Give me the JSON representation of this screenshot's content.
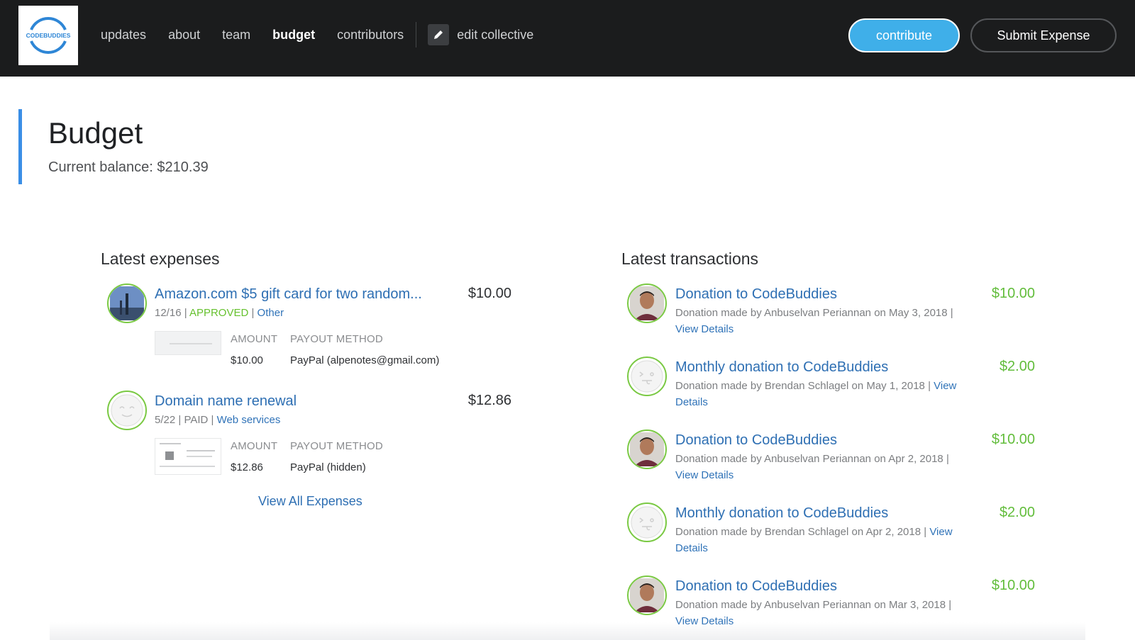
{
  "colors": {
    "topbar": "#1b1c1d",
    "accent": "#3a8ee6",
    "contribute": "#3fafe9",
    "green": "#62bd3b",
    "link": "#2e6fb3"
  },
  "logo": {
    "text": "CODEBUDDIES"
  },
  "nav": {
    "items": [
      "updates",
      "about",
      "team",
      "budget",
      "contributors"
    ],
    "active": "budget",
    "edit_label": "edit collective"
  },
  "buttons": {
    "contribute": "contribute",
    "submit_expense": "Submit Expense"
  },
  "header": {
    "title": "Budget",
    "balance": "Current balance: $210.39"
  },
  "expenses": {
    "title": "Latest expenses",
    "labels": {
      "amount": "AMOUNT",
      "payout": "PAYOUT METHOD"
    },
    "items": [
      {
        "title": "Amazon.com $5 gift card for two random...",
        "date": "12/16",
        "status": "APPROVED",
        "category": "Other",
        "amount": "$10.00",
        "detail_amount": "$10.00",
        "payout": "PayPal (alpenotes@gmail.com)"
      },
      {
        "title": "Domain name renewal",
        "date": "5/22",
        "status": "PAID",
        "category": "Web services",
        "amount": "$12.86",
        "detail_amount": "$12.86",
        "payout": "PayPal (hidden)"
      }
    ],
    "view_all": "View All Expenses"
  },
  "transactions": {
    "title": "Latest transactions",
    "view": "View",
    "details": "Details",
    "view_details": "View Details",
    "items": [
      {
        "title": "Donation to CodeBuddies",
        "desc": "Donation made by Anbuselvan Periannan on May 3, 2018 |",
        "amount": "$10.00",
        "avatar": "person-photo"
      },
      {
        "title": "Monthly donation to CodeBuddies",
        "desc": "Donation made by Brendan Schlagel on May 1, 2018 |",
        "amount": "$2.00",
        "avatar": "face-placeholder"
      },
      {
        "title": "Donation to CodeBuddies",
        "desc": "Donation made by Anbuselvan Periannan on Apr 2, 2018 |",
        "amount": "$10.00",
        "avatar": "person-photo"
      },
      {
        "title": "Monthly donation to CodeBuddies",
        "desc": "Donation made by Brendan Schlagel on Apr 2, 2018 |",
        "amount": "$2.00",
        "avatar": "face-placeholder"
      },
      {
        "title": "Donation to CodeBuddies",
        "desc": "Donation made by Anbuselvan Periannan on Mar 3, 2018 |",
        "amount": "$10.00",
        "avatar": "person-photo"
      }
    ]
  }
}
